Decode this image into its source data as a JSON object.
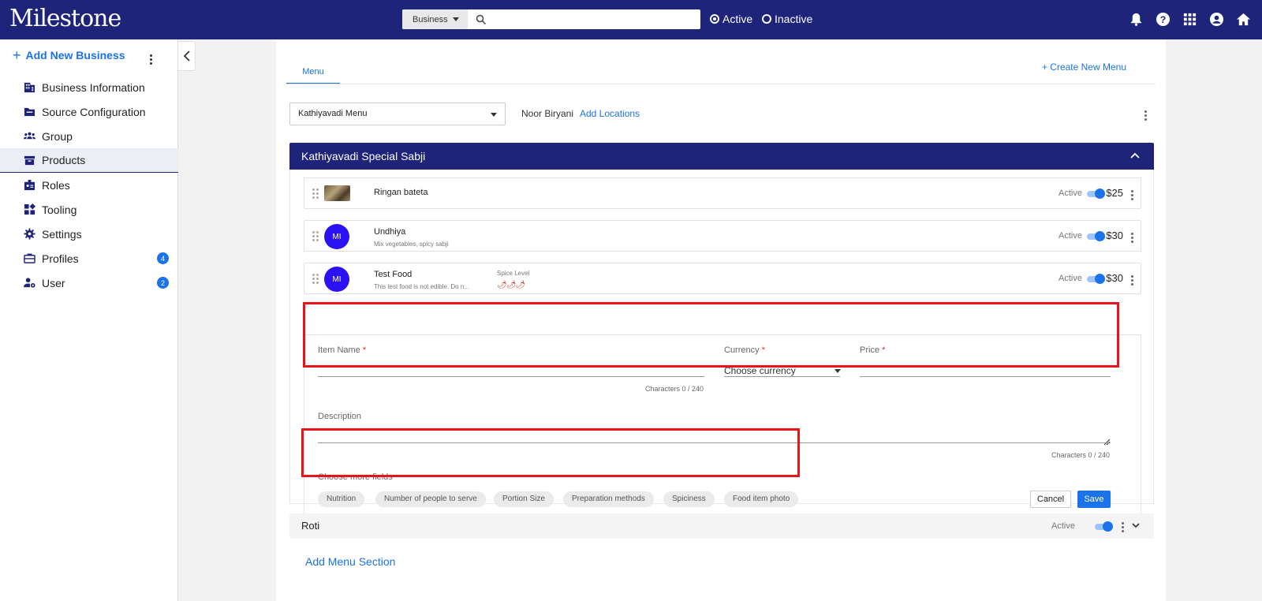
{
  "topbar": {
    "logo": "Milestone",
    "search": {
      "scope": "Business",
      "placeholder": ""
    },
    "filter_active": "Active",
    "filter_inactive": "Inactive"
  },
  "sidebar": {
    "add_business": "Add New Business",
    "items": [
      {
        "label": "Business Information",
        "icon": "building-icon"
      },
      {
        "label": "Source Configuration",
        "icon": "folder-icon"
      },
      {
        "label": "Group",
        "icon": "group-icon"
      },
      {
        "label": "Products",
        "icon": "archive-icon",
        "active": true
      },
      {
        "label": "Roles",
        "icon": "id-badge-icon"
      },
      {
        "label": "Tooling",
        "icon": "widgets-icon"
      },
      {
        "label": "Settings",
        "icon": "gear-icon"
      },
      {
        "label": "Profiles",
        "icon": "briefcase-icon",
        "badge": "4"
      },
      {
        "label": "User",
        "icon": "user-cog-icon",
        "badge": "2"
      }
    ]
  },
  "main": {
    "tab": "Menu",
    "create_menu": "Create New Menu",
    "menu_select": "Kathiyavadi Menu",
    "location_name": "Noor Biryani",
    "add_locations": "Add Locations",
    "section_title": "Kathiyavadi Special Sabji",
    "items": [
      {
        "name": "Ringan bateta",
        "desc": "",
        "status": "Active",
        "price": "$25",
        "avatar": ""
      },
      {
        "name": "Undhiya",
        "desc": "Mix vegetables, spicy sabji",
        "status": "Active",
        "price": "$30",
        "avatar": "MI"
      },
      {
        "name": "Test Food",
        "desc": "This test food is not edible. Do n...",
        "status": "Active",
        "price": "$30",
        "avatar": "MI",
        "spice_label": "Spice Level",
        "spice_icons": "🌶🌶🌶"
      }
    ],
    "form": {
      "item_name_label": "Item Name",
      "item_name_value": "",
      "item_name_count": "Characters 0 / 240",
      "currency_label": "Currency",
      "currency_value": "Choose currency",
      "price_label": "Price",
      "price_value": "",
      "required_mark": "*",
      "description_label": "Description",
      "description_count": "Characters 0 / 240",
      "more_fields_label": "Choose more fields",
      "chips": [
        "Nutrition",
        "Number of people to serve",
        "Portion Size",
        "Preparation methods",
        "Spiciness",
        "Food item photo"
      ],
      "cancel": "Cancel",
      "save": "Save"
    },
    "collapsed_section": {
      "title": "Roti",
      "status": "Active"
    },
    "add_menu_section": "Add Menu Section"
  },
  "colors": {
    "primary": "#1e2479",
    "accent": "#1a73e8",
    "highlight": "#e8141a"
  }
}
